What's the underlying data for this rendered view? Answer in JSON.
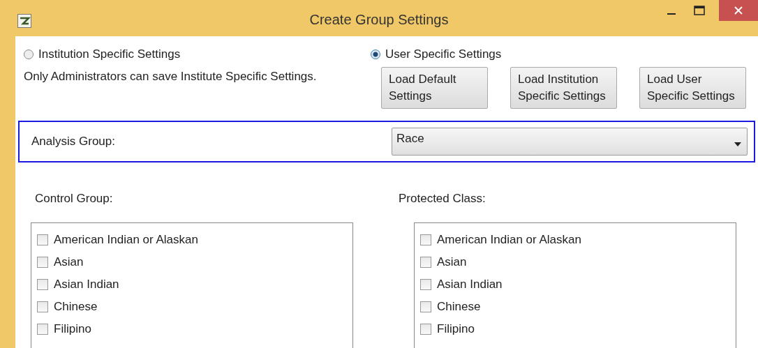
{
  "window": {
    "title": "Create Group Settings"
  },
  "scope_options": [
    {
      "label": "Institution Specific Settings",
      "selected": false
    },
    {
      "label": "User Specific Settings",
      "selected": true
    }
  ],
  "note": "Only Administrators can save Institute Specific Settings.",
  "buttons": [
    [
      "Load Default",
      "Settings"
    ],
    [
      "Load Institution",
      "Specific Settings"
    ],
    [
      "Load User",
      "Specific Settings"
    ]
  ],
  "analysis_group": {
    "label": "Analysis Group:",
    "value": "Race"
  },
  "lists": [
    {
      "title": "Control Group:",
      "items": [
        {
          "label": "American Indian or Alaskan",
          "checked": false
        },
        {
          "label": "Asian",
          "checked": false
        },
        {
          "label": "Asian Indian",
          "checked": false
        },
        {
          "label": "Chinese",
          "checked": false
        },
        {
          "label": "Filipino",
          "checked": false
        }
      ]
    },
    {
      "title": "Protected Class:",
      "items": [
        {
          "label": "American Indian or Alaskan",
          "checked": false
        },
        {
          "label": "Asian",
          "checked": false
        },
        {
          "label": "Asian Indian",
          "checked": false
        },
        {
          "label": "Chinese",
          "checked": false
        },
        {
          "label": "Filipino",
          "checked": false
        }
      ]
    }
  ]
}
